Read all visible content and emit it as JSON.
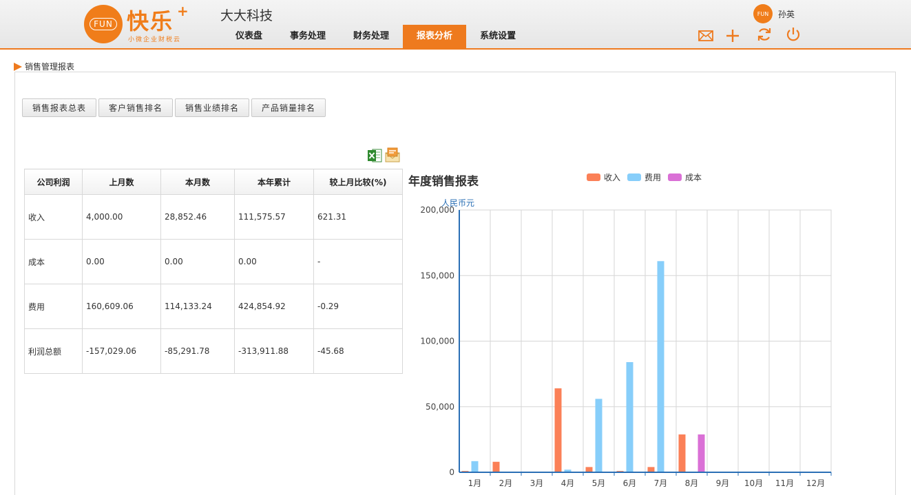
{
  "header": {
    "logo_badge": "FUN",
    "logo_text": "快乐",
    "logo_plus": "+",
    "logo_sub": "小微企业财税云",
    "company": "大大科技",
    "user_name": "孙英",
    "user_avatar": "FUN",
    "accent_color": "#ee7a1e"
  },
  "nav": {
    "items": [
      {
        "label": "仪表盘",
        "active": false
      },
      {
        "label": "事务处理",
        "active": false
      },
      {
        "label": "财务处理",
        "active": false
      },
      {
        "label": "报表分析",
        "active": true
      },
      {
        "label": "系统设置",
        "active": false
      }
    ]
  },
  "toolbar": {
    "icons": [
      "mail-icon",
      "plus-icon",
      "refresh-icon",
      "power-icon"
    ]
  },
  "breadcrumb": {
    "label": "销售管理报表"
  },
  "tabs": [
    "销售报表总表",
    "客户销售排名",
    "销售业绩排名",
    "产品销量排名"
  ],
  "table": {
    "headers": [
      "公司利润",
      "上月数",
      "本月数",
      "本年累计",
      "较上月比较(%)"
    ],
    "rows": [
      [
        "收入",
        "4,000.00",
        "28,852.46",
        "111,575.57",
        "621.31"
      ],
      [
        "成本",
        "0.00",
        "0.00",
        "0.00",
        "-"
      ],
      [
        "费用",
        "160,609.06",
        "114,133.24",
        "424,854.92",
        "-0.29"
      ],
      [
        "利润总额",
        "-157,029.06",
        "-85,291.78",
        "-313,911.88",
        "-45.68"
      ]
    ]
  },
  "chart_data": {
    "type": "bar",
    "title": "年度销售报表",
    "ylabel": "人民币元",
    "xlabel": "",
    "categories": [
      "1月",
      "2月",
      "3月",
      "4月",
      "5月",
      "6月",
      "7月",
      "8月",
      "9月",
      "10月",
      "11月",
      "12月"
    ],
    "series": [
      {
        "name": "收入",
        "color": "#fb8057",
        "values": [
          1000,
          8000,
          0,
          64000,
          4000,
          1000,
          4000,
          28852.46,
          0,
          0,
          0,
          0
        ]
      },
      {
        "name": "费用",
        "color": "#87cefa",
        "values": [
          8500,
          0,
          0,
          2000,
          56000,
          84000,
          161000,
          0,
          0,
          0,
          0,
          0
        ]
      },
      {
        "name": "成本",
        "color": "#da70d6",
        "values": [
          0,
          0,
          0,
          0,
          0,
          0,
          0,
          28852.46,
          0,
          0,
          0,
          0
        ]
      }
    ],
    "ylim": [
      0,
      200000
    ],
    "yticks": [
      0,
      50000,
      100000,
      150000,
      200000
    ],
    "ytick_labels": [
      "0",
      "50,000",
      "100,000",
      "150,000",
      "200,000"
    ],
    "grid": true,
    "legend_position": "top-right"
  }
}
